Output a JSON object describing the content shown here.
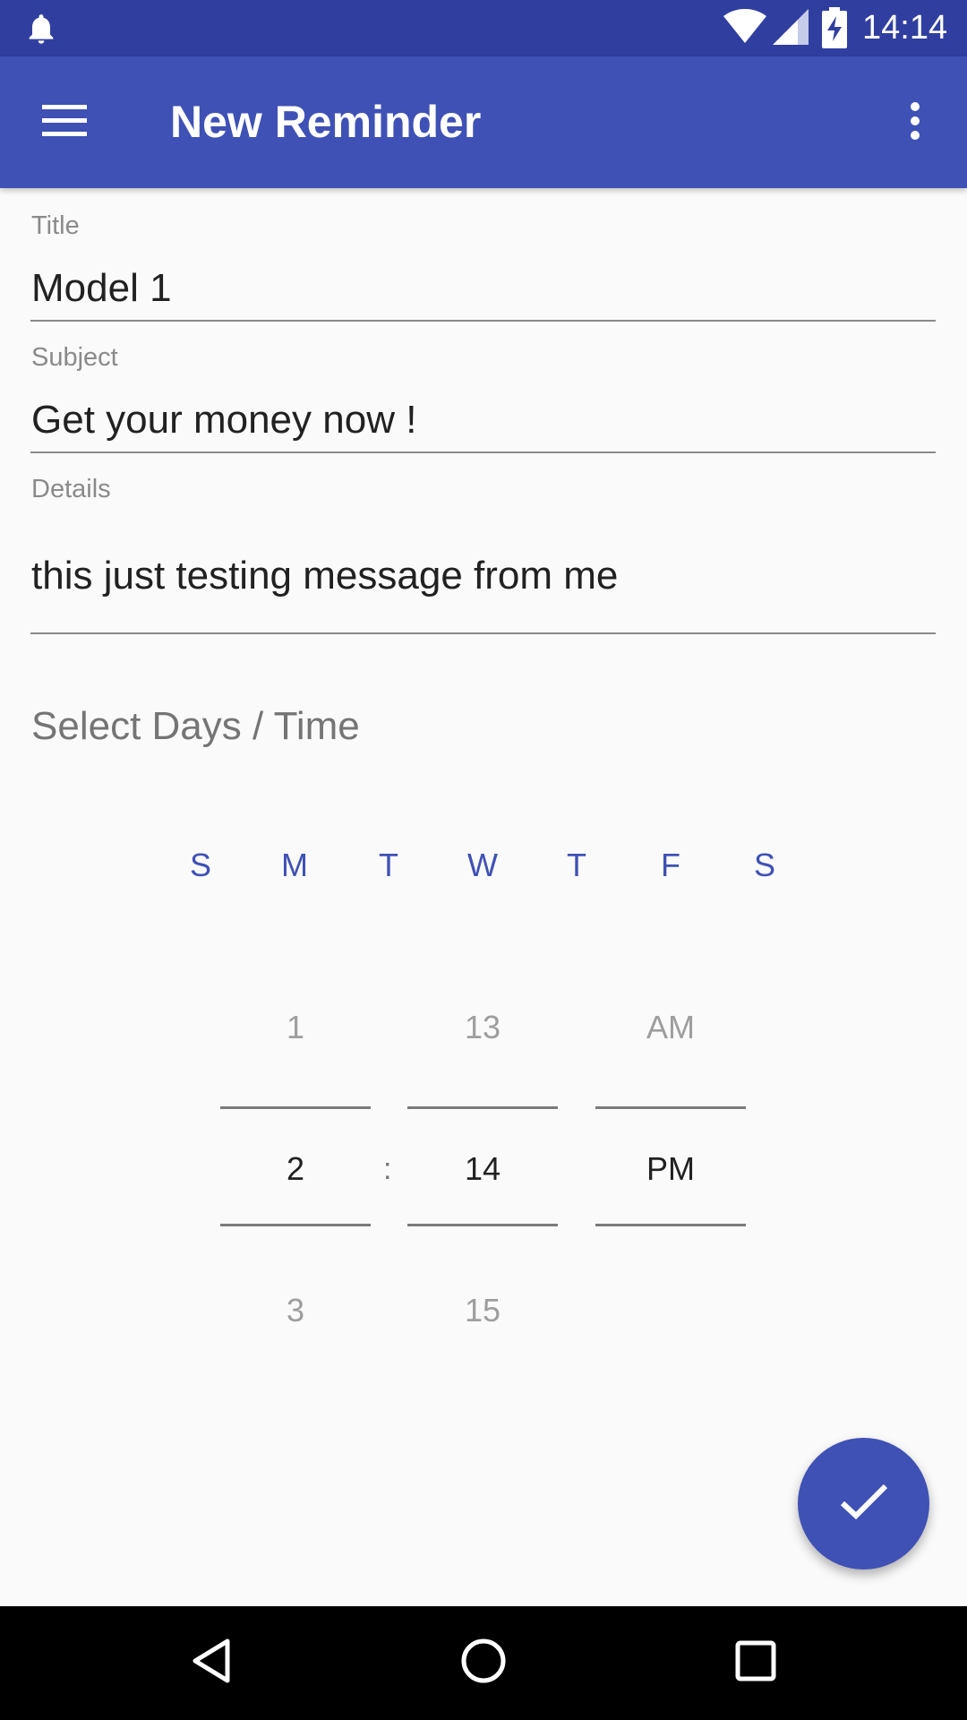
{
  "status_bar": {
    "time": "14:14",
    "icons": [
      "notification-bell-icon",
      "wifi-icon",
      "cell-signal-icon",
      "battery-charging-icon"
    ]
  },
  "app_bar": {
    "title": "New Reminder",
    "menu_icon": "hamburger-menu-icon",
    "more_icon": "more-vert-icon"
  },
  "form": {
    "title_label": "Title",
    "title_value": "Model 1",
    "subject_label": "Subject",
    "subject_value": "Get your money now !",
    "details_label": "Details",
    "details_value": "this just testing message from me"
  },
  "schedule": {
    "heading": "Select Days / Time",
    "days": [
      "S",
      "M",
      "T",
      "W",
      "T",
      "F",
      "S"
    ],
    "hour": {
      "above": "1",
      "selected": "2",
      "below": "3"
    },
    "separator": ":",
    "minute": {
      "above": "13",
      "selected": "14",
      "below": "15"
    },
    "ampm": {
      "above": "AM",
      "selected": "PM"
    }
  },
  "fab": {
    "icon": "check-icon"
  },
  "nav_bar": {
    "icons": [
      "back-icon",
      "home-icon",
      "recents-icon"
    ]
  },
  "colors": {
    "primary": "#3f51b5",
    "primary_dark": "#303f9f",
    "background": "#fafafa"
  }
}
